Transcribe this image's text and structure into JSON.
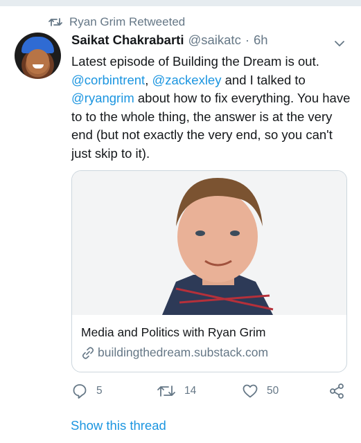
{
  "retweet": {
    "text": "Ryan Grim Retweeted"
  },
  "tweet": {
    "author_name": "Saikat Chakrabarti",
    "handle": "@saikatc",
    "separator": "·",
    "time": "6h",
    "text_parts": [
      {
        "text": "Latest episode of Building the Dream is out. ",
        "mention": false
      },
      {
        "text": "@corbintrent",
        "mention": true
      },
      {
        "text": ", ",
        "mention": false
      },
      {
        "text": "@zackexley",
        "mention": true
      },
      {
        "text": " and I talked to ",
        "mention": false
      },
      {
        "text": "@ryangrim",
        "mention": true
      },
      {
        "text": " about how to fix everything. You have to to the whole thing, the answer is at the very end (but not exactly the very end, so you can't just skip to it).",
        "mention": false
      }
    ]
  },
  "card": {
    "title": "Media and Politics with Ryan Grim",
    "domain": "buildingthedream.substack.com"
  },
  "actions": {
    "reply_count": "5",
    "retweet_count": "14",
    "like_count": "50"
  },
  "footer": {
    "show_thread": "Show this thread"
  },
  "icons": {
    "retweet": "retweet-icon",
    "chevron": "chevron-down-icon",
    "link": "link-icon",
    "reply": "reply-icon",
    "like": "heart-icon",
    "share": "share-icon"
  },
  "colors": {
    "link": "#1b95e0",
    "secondary_text": "#657786",
    "primary_text": "#14171a",
    "border": "#ccd6dd"
  }
}
